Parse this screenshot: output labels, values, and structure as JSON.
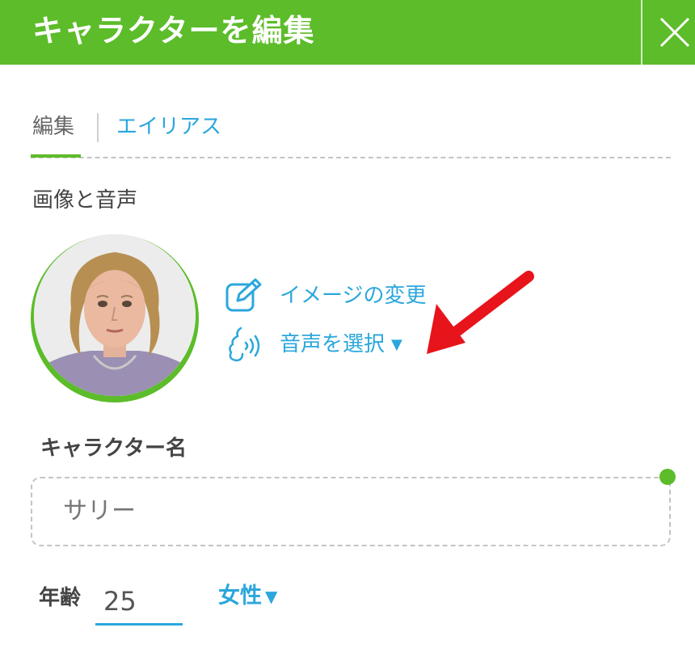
{
  "header": {
    "title": "キャラクターを編集",
    "close_icon": "close-icon"
  },
  "tabs": [
    {
      "label": "編集",
      "active": true
    },
    {
      "label": "エイリアス",
      "active": false
    }
  ],
  "section": {
    "title": "画像と音声"
  },
  "actions": {
    "change_image": "イメージの変更",
    "select_voice": "音声を選択",
    "dropdown_caret": "▼"
  },
  "character": {
    "name_label": "キャラクター名",
    "name_value": "サリー",
    "age_label": "年齢",
    "age_value": "25",
    "gender_value": "女性"
  },
  "colors": {
    "brand_green": "#5cbc2a",
    "link_blue": "#2ba7dc",
    "annotation_red": "#e8141b"
  }
}
